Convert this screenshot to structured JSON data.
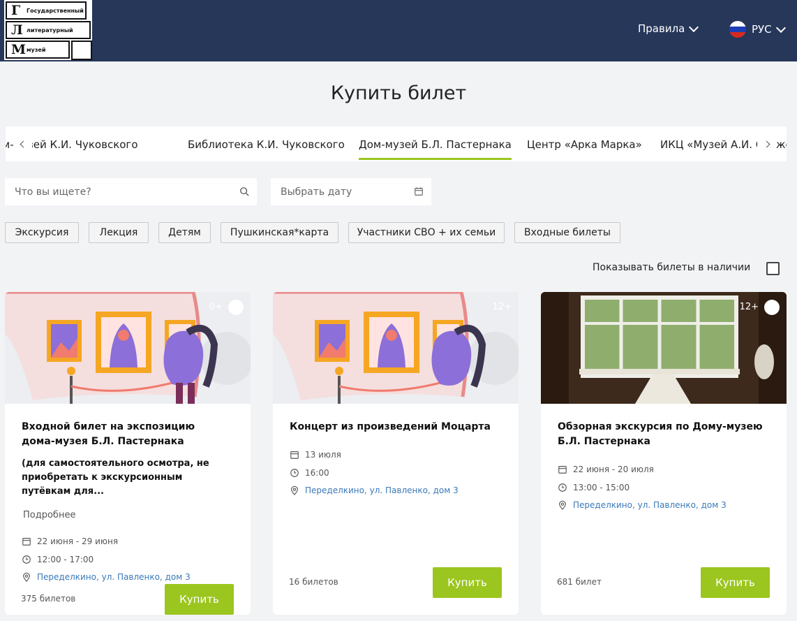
{
  "logo": {
    "row1_letter": "Г",
    "row1_word": "Государственный",
    "row2_letter": "Л",
    "row2_word": "литературный",
    "row3_letter": "М",
    "row3_word": "музей"
  },
  "header": {
    "rules_label": "Правила",
    "language_label": "РУС",
    "bg_color": "#26375a"
  },
  "page_title": "Купить билет",
  "tabs": [
    {
      "label": "Дом-музей К.И. Чуковского",
      "active": false
    },
    {
      "label": "Библиотека К.И. Чуковского",
      "active": false
    },
    {
      "label": "Дом-музей Б.Л. Пастернака",
      "active": true
    },
    {
      "label": "Центр «Арка Марка»",
      "active": false
    },
    {
      "label": "ИКЦ «Музей А.И. Солженицына»",
      "active": false
    }
  ],
  "search": {
    "placeholder": "Что вы ищете?"
  },
  "date": {
    "placeholder": "Выбрать дату"
  },
  "chips": [
    "Экскурсия",
    "Лекция",
    "Детям",
    "Пушкинская*карта",
    "Участники СВО + их семьи",
    "Входные билеты"
  ],
  "availability_label": "Показывать билеты в наличии",
  "accent_color": "#9bc61f",
  "cards": [
    {
      "age": "0+",
      "title": "Входной билет на экспозицию дома-музея Б.Л. Пастернака",
      "description": "(для самостоятельного осмотра, не приобретать к экскурсионным путёвкам для...",
      "more_label": "Подробнее",
      "dates": "22 июня - 29 июня",
      "time": "12:00 - 17:00",
      "location": "Переделкино, ул. Павленко, дом 3",
      "count": "375 билетов",
      "buy_label": "Купить"
    },
    {
      "age": "12+",
      "title": "Концерт из произведений Моцарта",
      "dates": "13 июля",
      "time": "16:00",
      "location": "Переделкино, ул. Павленко, дом 3",
      "count": "16 билетов",
      "buy_label": "Купить"
    },
    {
      "age": "12+",
      "title": "Обзорная экскурсия по Дому-музею Б.Л. Пастернака",
      "dates": "22 июня - 20 июля",
      "time": "13:00 - 15:00",
      "location": "Переделкино, ул. Павленко, дом 3",
      "count": "681 билет",
      "buy_label": "Купить"
    }
  ]
}
